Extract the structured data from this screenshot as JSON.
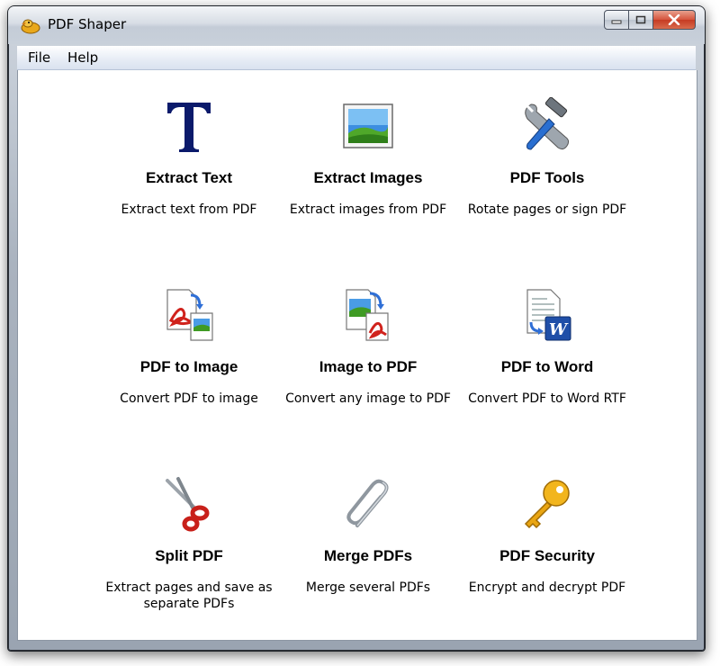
{
  "window": {
    "title": "PDF Shaper",
    "app_icon": "app-logo-icon"
  },
  "caption_buttons": {
    "minimize": "minimize-icon",
    "maximize": "maximize-icon",
    "close": "close-icon"
  },
  "menu": {
    "items": [
      {
        "label": "File"
      },
      {
        "label": "Help"
      }
    ]
  },
  "tools": [
    {
      "label": "Extract Text",
      "description": "Extract text from PDF",
      "icon": "text-t-icon"
    },
    {
      "label": "Extract Images",
      "description": "Extract images from PDF",
      "icon": "picture-icon"
    },
    {
      "label": "PDF Tools",
      "description": "Rotate pages or sign PDF",
      "icon": "wrench-hammer-icon"
    },
    {
      "label": "PDF to Image",
      "description": "Convert PDF to image",
      "icon": "pdf-to-image-icon"
    },
    {
      "label": "Image to PDF",
      "description": "Convert any image to PDF",
      "icon": "image-to-pdf-icon"
    },
    {
      "label": "PDF to Word",
      "description": "Convert PDF to Word RTF",
      "icon": "pdf-to-word-icon"
    },
    {
      "label": "Split PDF",
      "description": "Extract pages and save as separate PDFs",
      "icon": "scissors-icon"
    },
    {
      "label": "Merge PDFs",
      "description": "Merge several PDFs",
      "icon": "paperclip-icon"
    },
    {
      "label": "PDF Security",
      "description": "Encrypt and decrypt PDF",
      "icon": "key-icon"
    }
  ],
  "colors": {
    "close_button": "#c63b22",
    "menubar": "#e6ecf5",
    "titlebar": "#d7dde5"
  }
}
